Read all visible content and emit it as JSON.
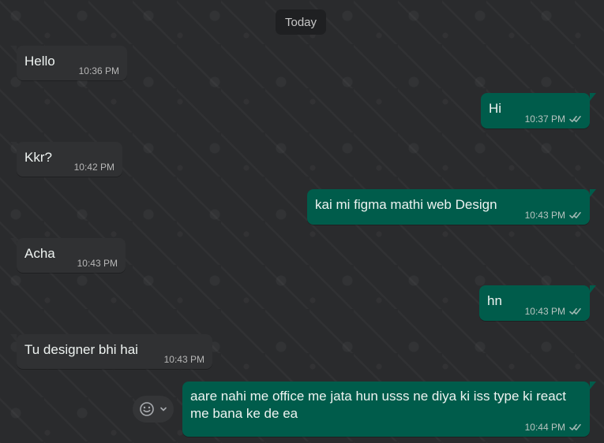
{
  "chat": {
    "day_label": "Today",
    "messages": [
      {
        "direction": "incoming",
        "text": "Hello",
        "time": "10:36 PM"
      },
      {
        "direction": "outgoing",
        "text": "Hi",
        "time": "10:37 PM"
      },
      {
        "direction": "incoming",
        "text": "Kkr?",
        "time": "10:42 PM"
      },
      {
        "direction": "outgoing",
        "text": "kai mi figma mathi web Design",
        "time": "10:43 PM"
      },
      {
        "direction": "incoming",
        "text": "Acha",
        "time": "10:43 PM"
      },
      {
        "direction": "outgoing",
        "text": "hn",
        "time": "10:43 PM"
      },
      {
        "direction": "incoming",
        "text": "Tu designer bhi hai",
        "time": "10:43 PM"
      },
      {
        "direction": "outgoing",
        "text": "aare nahi me office me jata hun usss ne diya ki iss type ki react\nme bana ke de ea",
        "time": "10:44 PM"
      }
    ]
  },
  "colors": {
    "background": "#2a2b2d",
    "incoming_bubble": "#303133",
    "outgoing_bubble": "#005c4b",
    "text": "#eef3f1",
    "read_check": "#9eb7b1"
  },
  "icons": {
    "read_status": "double-check-icon",
    "reaction": "smiley-icon",
    "menu": "chevron-down-icon"
  }
}
